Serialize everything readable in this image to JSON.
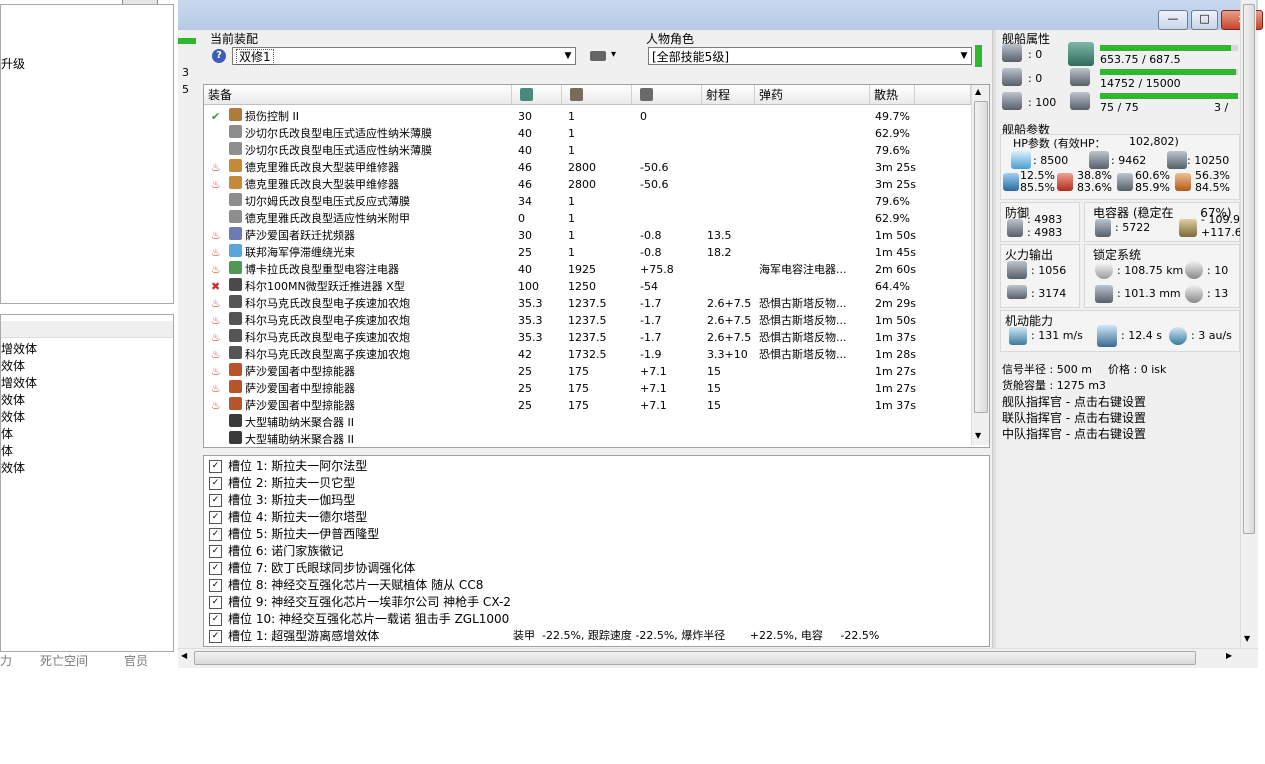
{
  "left": {
    "upgrade_label": "升级",
    "counters": [
      "3",
      "5"
    ],
    "implant_items": [
      "增效体",
      "效体",
      "增效体",
      "效体",
      "效体",
      "体",
      "体",
      "效体"
    ],
    "bottom_tabs": [
      "力",
      "死亡空间",
      "官员"
    ]
  },
  "window": {
    "min_glyph": "—",
    "max_glyph": "□",
    "close_glyph": "x"
  },
  "fitting": {
    "label": "当前装配",
    "value": "双修1",
    "help_glyph": "?"
  },
  "character": {
    "label": "人物角色",
    "value": "[全部技能5级]"
  },
  "equipment": {
    "headers": [
      "装备",
      "",
      "",
      "",
      "射程",
      "弹药",
      "散热"
    ],
    "rows": [
      {
        "name": "损伤控制 II",
        "mark": "check",
        "icon": "#b07a3c",
        "c1": "30",
        "c2": "1",
        "c3": "0",
        "range": "",
        "ammo": "",
        "heat": "49.7%"
      },
      {
        "name": "沙切尔氏改良型电压式适应性纳米薄膜",
        "mark": "",
        "icon": "#8e8e8e",
        "c1": "40",
        "c2": "1",
        "c3": "",
        "range": "",
        "ammo": "",
        "heat": "62.9%"
      },
      {
        "name": "沙切尔氏改良型电压式适应性纳米薄膜",
        "mark": "",
        "icon": "#8e8e8e",
        "c1": "40",
        "c2": "1",
        "c3": "",
        "range": "",
        "ammo": "",
        "heat": "79.6%"
      },
      {
        "name": "德克里雅氏改良大型装甲维修器",
        "mark": "fire",
        "icon": "#c48a3a",
        "c1": "46",
        "c2": "2800",
        "c3": "-50.6",
        "range": "",
        "ammo": "",
        "heat": "3m 25s"
      },
      {
        "name": "德克里雅氏改良大型装甲维修器",
        "mark": "fire",
        "icon": "#c48a3a",
        "c1": "46",
        "c2": "2800",
        "c3": "-50.6",
        "range": "",
        "ammo": "",
        "heat": "3m 25s"
      },
      {
        "name": "切尔姆氏改良型电压式反应式薄膜",
        "mark": "",
        "icon": "#8e8e8e",
        "c1": "34",
        "c2": "1",
        "c3": "",
        "range": "",
        "ammo": "",
        "heat": "79.6%"
      },
      {
        "name": "德克里雅氏改良型适应性纳米附甲",
        "mark": "",
        "icon": "#8e8e8e",
        "c1": "0",
        "c2": "1",
        "c3": "",
        "range": "",
        "ammo": "",
        "heat": "62.9%"
      },
      {
        "name": "萨沙爱国者跃迁扰频器",
        "mark": "fire",
        "icon": "#6a7bb5",
        "c1": "30",
        "c2": "1",
        "c3": "-0.8",
        "range": "13.5",
        "ammo": "",
        "heat": "1m 50s"
      },
      {
        "name": "联邦海军停滞缠绕光束",
        "mark": "fire",
        "icon": "#59a7d8",
        "c1": "25",
        "c2": "1",
        "c3": "-0.8",
        "range": "18.2",
        "ammo": "",
        "heat": "1m 45s"
      },
      {
        "name": "博卡拉氏改良型重型电容注电器",
        "mark": "fire",
        "icon": "#4e9a52",
        "c1": "40",
        "c2": "1925",
        "c3": "+75.8",
        "range": "",
        "ammo": "海军电容注电器...",
        "heat": "2m 60s"
      },
      {
        "name": "科尔100MN微型跃迁推进器 X型",
        "mark": "x",
        "icon": "#4b4b4b",
        "c1": "100",
        "c2": "1250",
        "c3": "-54",
        "range": "",
        "ammo": "",
        "heat": "64.4%"
      },
      {
        "name": "科尔马克氏改良型电子疾速加农炮",
        "mark": "fire",
        "icon": "#555555",
        "c1": "35.3",
        "c2": "1237.5",
        "c3": "-1.7",
        "range": "2.6+7.5",
        "ammo": "恐惧古斯塔反物...",
        "heat": "2m 29s"
      },
      {
        "name": "科尔马克氏改良型电子疾速加农炮",
        "mark": "fire",
        "icon": "#555555",
        "c1": "35.3",
        "c2": "1237.5",
        "c3": "-1.7",
        "range": "2.6+7.5",
        "ammo": "恐惧古斯塔反物...",
        "heat": "1m 50s"
      },
      {
        "name": "科尔马克氏改良型电子疾速加农炮",
        "mark": "fire",
        "icon": "#555555",
        "c1": "35.3",
        "c2": "1237.5",
        "c3": "-1.7",
        "range": "2.6+7.5",
        "ammo": "恐惧古斯塔反物...",
        "heat": "1m 37s"
      },
      {
        "name": "科尔马克氏改良型离子疾速加农炮",
        "mark": "fire",
        "icon": "#555555",
        "c1": "42",
        "c2": "1732.5",
        "c3": "-1.9",
        "range": "3.3+10",
        "ammo": "恐惧古斯塔反物...",
        "heat": "1m 28s"
      },
      {
        "name": "萨沙爱国者中型掠能器",
        "mark": "fire",
        "icon": "#b9532c",
        "c1": "25",
        "c2": "175",
        "c3": "+7.1",
        "range": "15",
        "ammo": "",
        "heat": "1m 27s"
      },
      {
        "name": "萨沙爱国者中型掠能器",
        "mark": "fire",
        "icon": "#b9532c",
        "c1": "25",
        "c2": "175",
        "c3": "+7.1",
        "range": "15",
        "ammo": "",
        "heat": "1m 27s"
      },
      {
        "name": "萨沙爱国者中型掠能器",
        "mark": "fire",
        "icon": "#b9532c",
        "c1": "25",
        "c2": "175",
        "c3": "+7.1",
        "range": "15",
        "ammo": "",
        "heat": "1m 37s"
      },
      {
        "name": "大型辅助纳米聚合器 II",
        "mark": "",
        "icon": "#3a3a3a",
        "c1": "",
        "c2": "",
        "c3": "",
        "range": "",
        "ammo": "",
        "heat": ""
      },
      {
        "name": "大型辅助纳米聚合器 II",
        "mark": "",
        "icon": "#3a3a3a",
        "c1": "",
        "c2": "",
        "c3": "",
        "range": "",
        "ammo": "",
        "heat": ""
      }
    ]
  },
  "slots": [
    "槽位 1: 斯拉夫一阿尔法型",
    "槽位 2: 斯拉夫一贝它型",
    "槽位 3: 斯拉夫一伽玛型",
    "槽位 4: 斯拉夫一德尔塔型",
    "槽位 5: 斯拉夫一伊普西隆型",
    "槽位 6: 诺门家族徽记",
    "槽位 7: 欧丁氏眼球同步协调强化体",
    "槽位 8: 神经交互强化芯片一天赋植体 随从 CC8",
    "槽位 9: 神经交互强化芯片一埃菲尔公司 神枪手 CX-2",
    "槽位 10: 神经交互强化芯片一载诺 狙击手 ZGL1000",
    "槽位 1: 超强型游离感增效体"
  ],
  "booster_effect": "装甲  -22.5%, 跟踪速度 -22.5%, 爆炸半径       +22.5%, 电容     -22.5%",
  "ship": {
    "attr_title": "舰船属性",
    "attr_left": [
      ": 0",
      ": 0",
      ": 100"
    ],
    "cpu": "653.75 / 687.5",
    "cpu_fill": 0.951,
    "power": "14752 / 15000",
    "power_fill": 0.983,
    "calib": "75 / 75",
    "calib_fill": 1.0,
    "calib_right": "3 /",
    "param_title": "舰船参数",
    "hp_label": "HP参数 (有效HP：",
    "hp_value": "102,802)",
    "shield": ": 8500",
    "armor": ": 9462",
    "hull": ": 10250",
    "res": [
      {
        "a": "12.5%",
        "b": "85.5%"
      },
      {
        "a": "38.8%",
        "b": "83.6%"
      },
      {
        "a": "60.6%",
        "b": "85.9%"
      },
      {
        "a": "56.3%",
        "b": "84.5%"
      }
    ],
    "defense_title": "防御",
    "defense_1": ": 4983",
    "defense_2": ": 4983",
    "cap_title": "电容器 (稳定在       67%)",
    "cap_value": ": 5722",
    "cap_delta1": "- 109.9",
    "cap_delta2": "+117.6",
    "fire_title": "火力输出",
    "dps": ": 1056",
    "volley": ": 3174",
    "lock_title": "锁定系统",
    "lock_range": ": 108.75 km",
    "lock_targets": ": 10",
    "scan_res": ": 101.3 mm",
    "sensor": ": 13",
    "mobility_title": "机动能力",
    "speed": ": 131 m/s",
    "align": ": 12.4 s",
    "warp": ": 3 au/s",
    "sig": "信号半径 : 500 m",
    "price": "价格 : 0 isk",
    "cargo": "货舱容量 : 1275 m3",
    "fleet_boss": "舰队指挥官 - 点击右键设置",
    "wing_boss": "联队指挥官 - 点击右键设置",
    "squad_boss": "中队指挥官 - 点击右键设置"
  }
}
